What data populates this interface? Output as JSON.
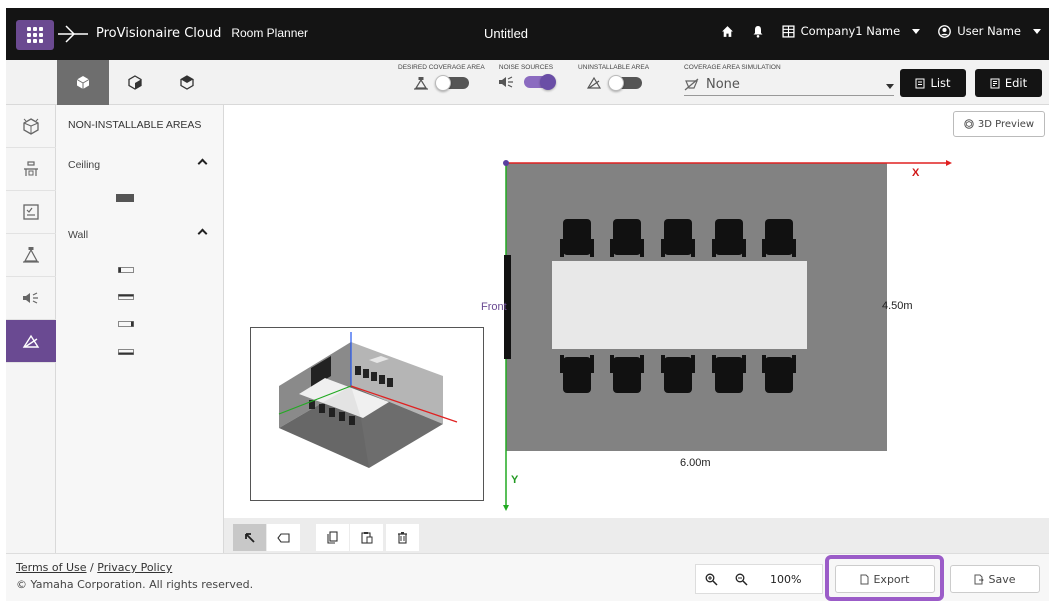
{
  "header": {
    "brand": "ProVisionaire Cloud",
    "app_name": "Room Planner",
    "doc_title": "Untitled",
    "company": "Company1 Name",
    "user": "User Name",
    "icons": [
      "grid-menu-icon",
      "home-icon",
      "bell-icon",
      "building-icon",
      "user-circle-icon"
    ]
  },
  "toolbar": {
    "view_tabs": [
      {
        "name": "3d-view-front-icon",
        "active": true
      },
      {
        "name": "3d-view-side-icon",
        "active": false
      },
      {
        "name": "3d-view-top-icon",
        "active": false
      }
    ],
    "toggles": [
      {
        "label": "DESIRED COVERAGE AREA",
        "state": "off"
      },
      {
        "label": "NOISE SOURCES",
        "state": "on"
      },
      {
        "label": "UNINSTALLABLE AREA",
        "state": "off"
      }
    ],
    "coverage_sim_label": "COVERAGE AREA SIMULATION",
    "coverage_sim_value": "None",
    "list_label": "List",
    "edit_label": "Edit"
  },
  "rail": {
    "items": [
      {
        "name": "rail-room-icon",
        "active": false
      },
      {
        "name": "rail-furniture-icon",
        "active": false
      },
      {
        "name": "rail-checklist-icon",
        "active": false
      },
      {
        "name": "rail-coverage-icon",
        "active": false
      },
      {
        "name": "rail-noise-icon",
        "active": false
      },
      {
        "name": "rail-uninstallable-icon",
        "active": true
      }
    ]
  },
  "panel": {
    "title": "NON-INSTALLABLE AREAS",
    "sections": [
      {
        "label": "Ceiling"
      },
      {
        "label": "Wall"
      }
    ]
  },
  "canvas": {
    "preview_label": "3D Preview",
    "axis_x": "X",
    "axis_y": "Y",
    "front_label": "Front",
    "width_label": "6.00m",
    "depth_label": "4.50m",
    "colors": {
      "room": "#828282",
      "table": "#e8e8e8",
      "chair": "#111111",
      "x_axis": "#e02020",
      "y_axis": "#22aa22",
      "accent": "#6a4a92"
    }
  },
  "footer": {
    "terms": "Terms of Use",
    "separator": "/",
    "privacy": "Privacy Policy",
    "copyright": "© Yamaha Corporation. All rights reserved.",
    "zoom": "100%",
    "export_label": "Export",
    "save_label": "Save"
  }
}
